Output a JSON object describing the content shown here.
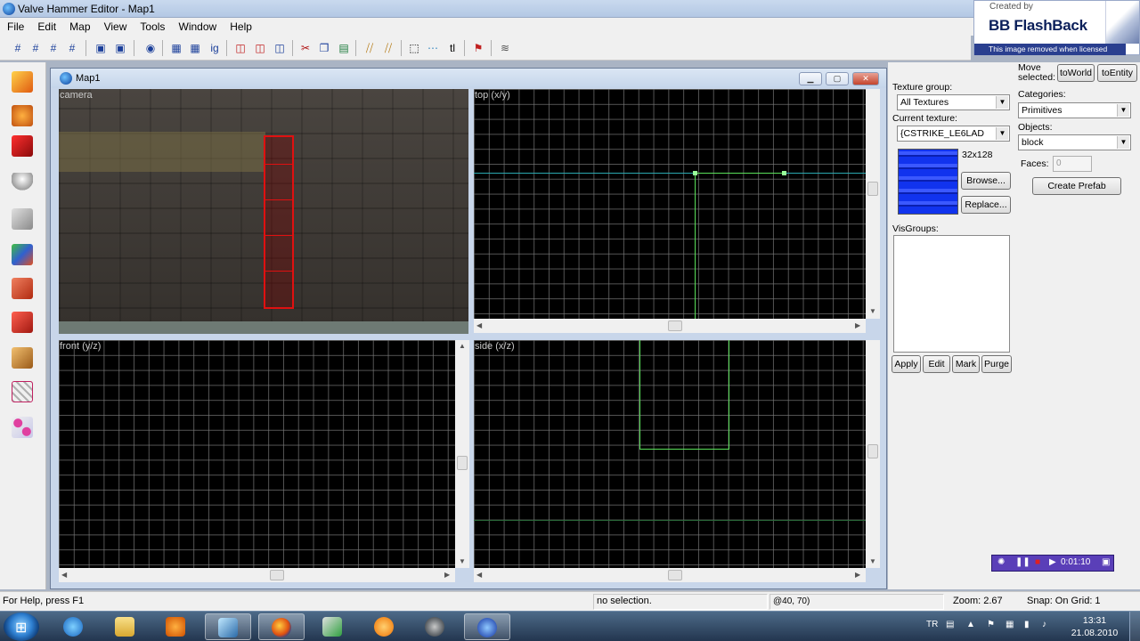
{
  "titlebar": {
    "title": "Valve Hammer Editor - Map1"
  },
  "menu": [
    "File",
    "Edit",
    "Map",
    "View",
    "Tools",
    "Window",
    "Help"
  ],
  "watermark": {
    "created_by": "Created by",
    "brand": "BB FlashBack",
    "note": "This image removed when licensed"
  },
  "map_window": {
    "title": "Map1",
    "viewports": {
      "camera": "camera",
      "top": "top (x/y)",
      "front": "front (y/z)",
      "side": "side (x/z)"
    }
  },
  "texture_panel": {
    "group_label": "Texture group:",
    "group_value": "All Textures",
    "current_label": "Current texture:",
    "current_value": "{CSTRIKE_LE6LAD",
    "size": "32x128",
    "browse": "Browse...",
    "replace": "Replace...",
    "visgroups_label": "VisGroups:",
    "apply": "Apply",
    "edit": "Edit",
    "mark": "Mark",
    "purge": "Purge"
  },
  "object_panel": {
    "move_selected": "Move selected:",
    "to_world": "toWorld",
    "to_entity": "toEntity",
    "categories_label": "Categories:",
    "categories_value": "Primitives",
    "objects_label": "Objects:",
    "objects_value": "block",
    "faces_label": "Faces:",
    "faces_value": "0",
    "create_prefab": "Create Prefab"
  },
  "recorder": {
    "time": "0:01:10"
  },
  "statusbar": {
    "help": "For Help, press F1",
    "selection": "no selection.",
    "coords": "@40, 70)",
    "zoom": "Zoom: 2.67",
    "snap": "Snap: On Grid: 1"
  },
  "taskbar": {
    "lang": "TR",
    "time": "13:31",
    "date": "21.08.2010"
  },
  "colors": {
    "grid": "#787878",
    "selection_green": "#5ae05a",
    "axis_cyan": "#2aa8b0",
    "brush_red": "#e01010"
  }
}
